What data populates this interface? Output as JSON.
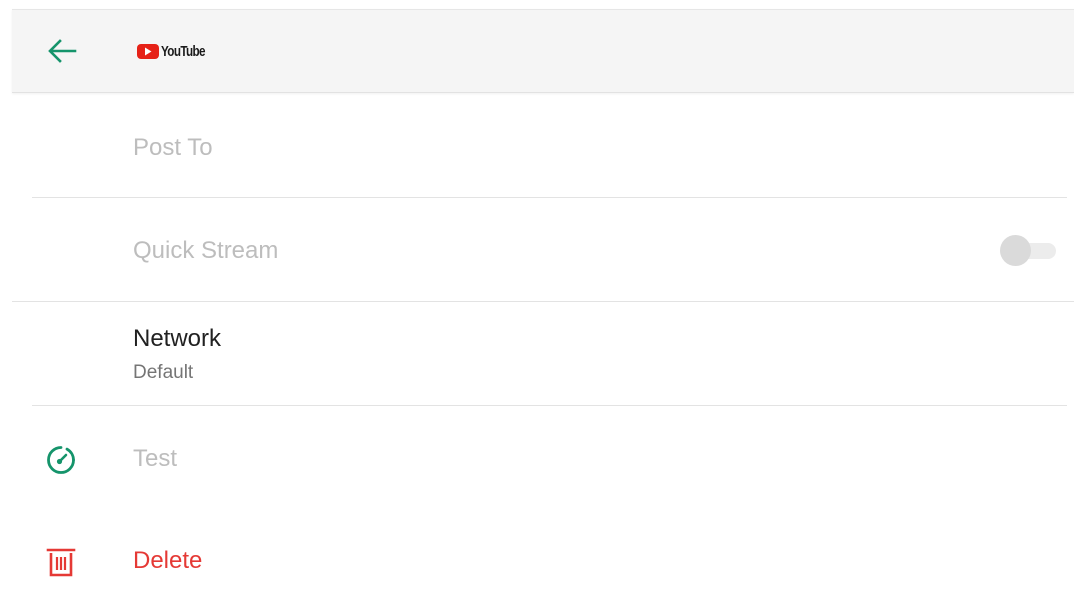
{
  "header": {
    "back_icon": "arrow-back-icon",
    "logo_text": "YouTube",
    "logo_icon": "youtube-play-icon"
  },
  "settings": {
    "post_to": {
      "label": "Post To"
    },
    "quick_stream": {
      "label": "Quick Stream",
      "enabled": false
    },
    "network": {
      "label": "Network",
      "value": "Default"
    },
    "test": {
      "label": "Test",
      "icon": "speedometer-icon"
    },
    "delete": {
      "label": "Delete",
      "icon": "trash-icon"
    }
  },
  "colors": {
    "accent": "#15946b",
    "danger": "#e53935",
    "disabled_text": "#bdbdbd",
    "header_bg": "#f5f5f5",
    "youtube_red": "#e62117"
  }
}
